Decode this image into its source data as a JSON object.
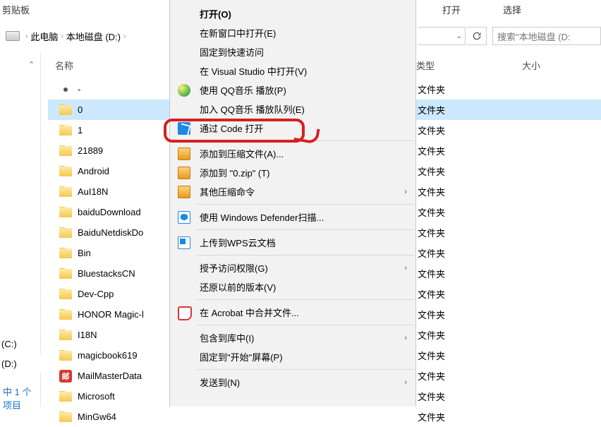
{
  "ribbon": {
    "clipboard_group": "剪贴板",
    "open_group": "打开",
    "select_group": "选择"
  },
  "breadcrumb": {
    "this_pc": "此电脑",
    "drive": "本地磁盘 (D:)"
  },
  "search": {
    "placeholder": "搜索\"本地磁盘 (D:"
  },
  "columns": {
    "name": "名称",
    "type": "类型",
    "size": "大小"
  },
  "nav": {
    "c_drive": "(C:)",
    "d_drive": "(D:)",
    "footer": "中 1 个项目"
  },
  "type_folder": "文件夹",
  "files": [
    {
      "name": "-",
      "icon": "dot"
    },
    {
      "name": "0",
      "icon": "folder",
      "selected": true
    },
    {
      "name": "1",
      "icon": "folder"
    },
    {
      "name": "21889",
      "icon": "folder"
    },
    {
      "name": "Android",
      "icon": "folder"
    },
    {
      "name": "AuI18N",
      "icon": "folder"
    },
    {
      "name": "baiduDownload",
      "icon": "folder"
    },
    {
      "name": "BaiduNetdiskDo",
      "icon": "folder"
    },
    {
      "name": "Bin",
      "icon": "folder"
    },
    {
      "name": "BluestacksCN",
      "icon": "folder"
    },
    {
      "name": "Dev-Cpp",
      "icon": "folder"
    },
    {
      "name": "HONOR Magic-l",
      "icon": "folder"
    },
    {
      "name": "I18N",
      "icon": "folder"
    },
    {
      "name": "magicbook619",
      "icon": "folder"
    },
    {
      "name": "MailMasterData",
      "icon": "mail"
    },
    {
      "name": "Microsoft",
      "icon": "folder"
    },
    {
      "name": "MinGw64",
      "icon": "folder"
    }
  ],
  "menu": [
    {
      "label": "打开(O)",
      "bold": true
    },
    {
      "label": "在新窗口中打开(E)"
    },
    {
      "label": "固定到快速访问"
    },
    {
      "label": "在 Visual Studio 中打开(V)"
    },
    {
      "label": "使用 QQ音乐 播放(P)",
      "icon": "qq-music"
    },
    {
      "label": "加入 QQ音乐 播放队列(E)"
    },
    {
      "label": "通过 Code 打开",
      "icon": "vscode",
      "highlighted": true
    },
    {
      "sep": true
    },
    {
      "label": "添加到压缩文件(A)...",
      "icon": "zip-icon"
    },
    {
      "label": "添加到 \"0.zip\" (T)",
      "icon": "zip-icon"
    },
    {
      "label": "其他压缩命令",
      "icon": "zip-icon",
      "submenu": true
    },
    {
      "sep": true
    },
    {
      "label": "使用 Windows Defender扫描...",
      "icon": "defender"
    },
    {
      "sep": true
    },
    {
      "label": "上传到WPS云文档",
      "icon": "wps-icon"
    },
    {
      "sep": true
    },
    {
      "label": "授予访问权限(G)",
      "submenu": true
    },
    {
      "label": "还原以前的版本(V)"
    },
    {
      "sep": true
    },
    {
      "label": "在 Acrobat 中合并文件...",
      "icon": "acrobat"
    },
    {
      "sep": true
    },
    {
      "label": "包含到库中(I)",
      "submenu": true
    },
    {
      "label": "固定到\"开始\"屏幕(P)"
    },
    {
      "sep": true
    },
    {
      "label": "发送到(N)",
      "submenu": true
    }
  ]
}
